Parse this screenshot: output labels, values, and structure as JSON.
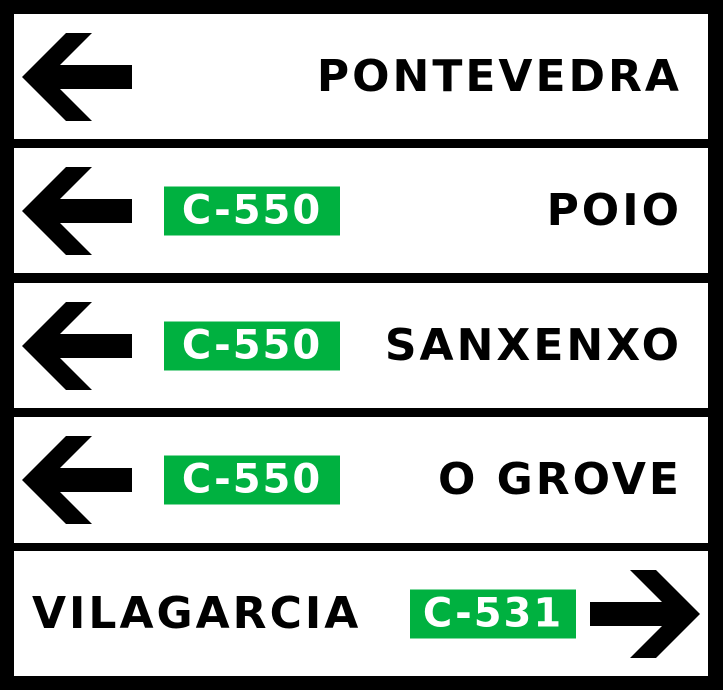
{
  "sign": {
    "colors": {
      "background": "#000000",
      "panel": "#ffffff",
      "text": "#000000",
      "road_badge": "#00b140",
      "road_badge_text": "#ffffff"
    },
    "rows": [
      {
        "direction": "left",
        "arrow_icon": "arrow-left-icon",
        "destination": "PONTEVEDRA",
        "road": ""
      },
      {
        "direction": "left",
        "arrow_icon": "arrow-left-icon",
        "destination": "POIO",
        "road": "C-550"
      },
      {
        "direction": "left",
        "arrow_icon": "arrow-left-icon",
        "destination": "SANXENXO",
        "road": "C-550"
      },
      {
        "direction": "left",
        "arrow_icon": "arrow-left-icon",
        "destination": "O GROVE",
        "road": "C-550"
      },
      {
        "direction": "right",
        "arrow_icon": "arrow-right-icon",
        "destination": "VILAGARCIA",
        "road": "C-531"
      }
    ]
  }
}
